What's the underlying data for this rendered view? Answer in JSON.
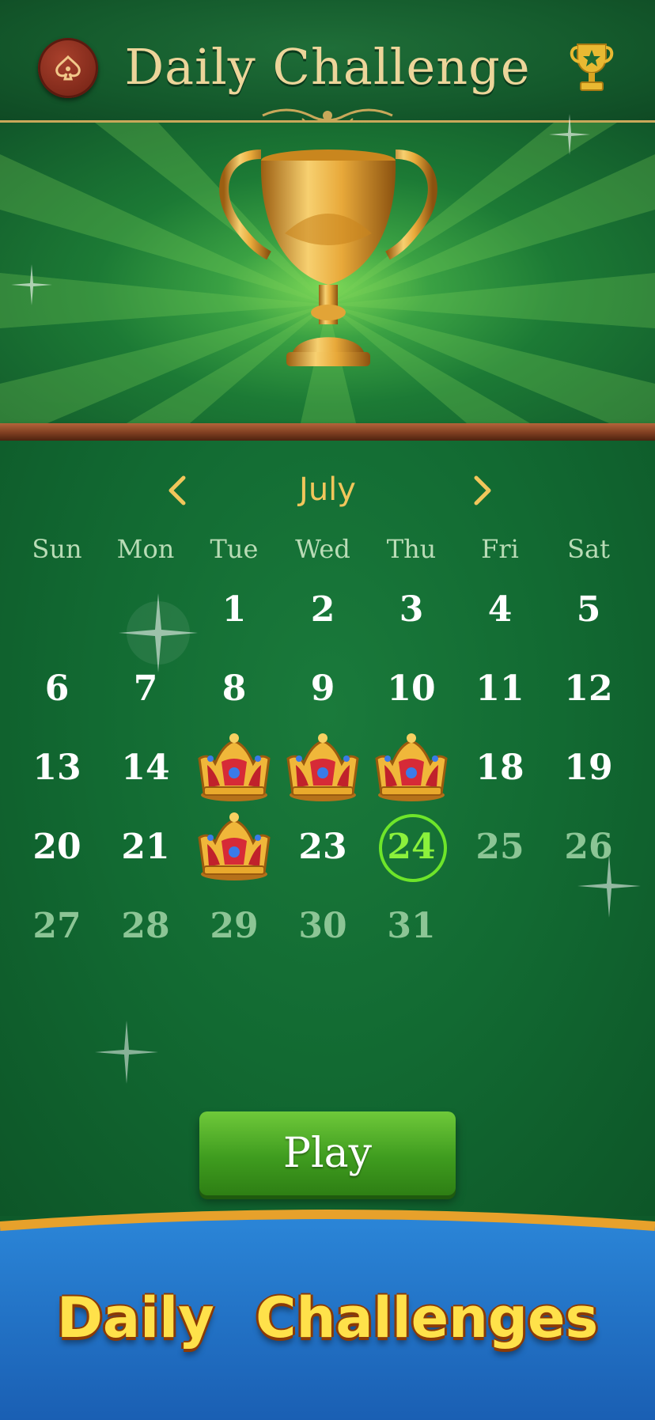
{
  "header": {
    "title": "Daily Challenge",
    "back_icon": "spade-back-icon",
    "trophy_icon": "trophy-icon"
  },
  "calendar": {
    "month": "July",
    "weekdays": [
      "Sun",
      "Mon",
      "Tue",
      "Wed",
      "Thu",
      "Fri",
      "Sat"
    ],
    "today": 24,
    "completed_days": [
      15,
      16,
      17,
      22
    ],
    "days_in_month": 31,
    "first_weekday_index": 2
  },
  "play_button": {
    "label": "Play"
  },
  "banner": {
    "text": "Daily Challenges"
  },
  "colors": {
    "title": "#ecd59a",
    "month": "#f1c65b",
    "today_ring": "#6ee52a",
    "future_day": "#8cc595",
    "play_button": "#4caf2a",
    "banner_blue": "#1f6fc4",
    "banner_text": "#ffe14a"
  }
}
